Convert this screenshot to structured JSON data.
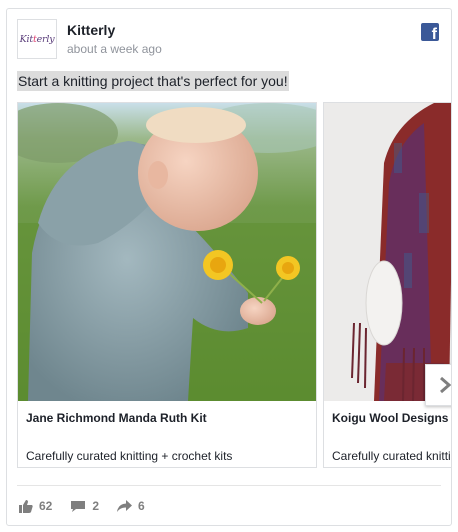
{
  "post": {
    "page_name": "Kitterly",
    "timestamp": "about a week ago",
    "avatar_logo": "Kitterly",
    "text": "Start a knitting project that's perfect for you!",
    "platform_icon": "facebook-icon"
  },
  "carousel": {
    "items": [
      {
        "title": "Jane Richmond Manda Ruth Kit",
        "description": "Carefully curated knitting + crochet kits",
        "image": "baby in knitted sweater holding dandelions"
      },
      {
        "title": "Koigu Wool Designs",
        "description": "Carefully curated knitting + crochet kits",
        "image": "knitted shawl on mannequin"
      }
    ],
    "next_icon": "chevron-right-icon"
  },
  "reactions": {
    "likes": "62",
    "comments": "2",
    "shares": "6"
  },
  "colors": {
    "facebook_blue": "#3b5998",
    "muted_text": "#90949c",
    "action_gray": "#7f7f7f"
  }
}
